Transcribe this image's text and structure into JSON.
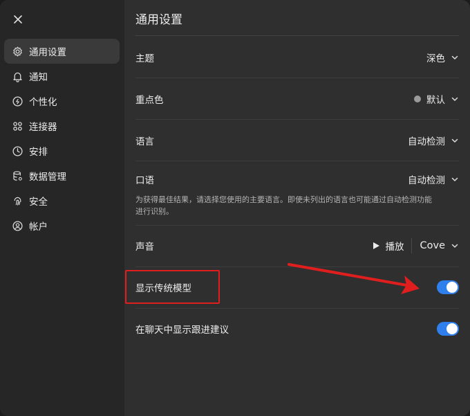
{
  "window": {
    "close_icon": "close-icon"
  },
  "sidebar": {
    "items": [
      {
        "label": "通用设置",
        "icon": "gear-icon",
        "active": true
      },
      {
        "label": "通知",
        "icon": "bell-icon",
        "active": false
      },
      {
        "label": "个性化",
        "icon": "personalize-icon",
        "active": false
      },
      {
        "label": "连接器",
        "icon": "connectors-icon",
        "active": false
      },
      {
        "label": "安排",
        "icon": "clock-icon",
        "active": false
      },
      {
        "label": "数据管理",
        "icon": "database-icon",
        "active": false
      },
      {
        "label": "安全",
        "icon": "fingerprint-icon",
        "active": false
      },
      {
        "label": "帐户",
        "icon": "account-icon",
        "active": false
      }
    ]
  },
  "main": {
    "title": "通用设置",
    "theme": {
      "label": "主题",
      "value": "深色"
    },
    "accent": {
      "label": "重点色",
      "value": "默认"
    },
    "language": {
      "label": "语言",
      "value": "自动检测"
    },
    "spoken": {
      "label": "口语",
      "value": "自动检测",
      "help": "为获得最佳结果，请选择您使用的主要语言。即使未列出的语言也可能通过自动检测功能进行识别。"
    },
    "voice": {
      "label": "声音",
      "play_label": "播放",
      "value": "Cove"
    },
    "legacy_models": {
      "label": "显示传统模型",
      "enabled": true
    },
    "follow_ups": {
      "label": "在聊天中显示跟进建议",
      "enabled": true
    }
  },
  "colors": {
    "toggle_on": "#2f80ed",
    "annotation": "#e01e1e"
  }
}
